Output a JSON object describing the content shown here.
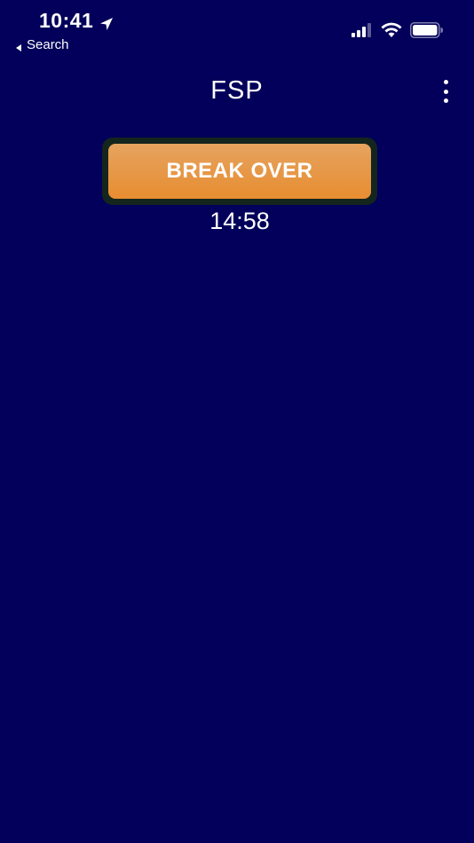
{
  "status_bar": {
    "time": "10:41",
    "back_label": "Search",
    "icons": [
      "location-arrow-icon",
      "signal-icon",
      "wifi-icon",
      "battery-icon"
    ]
  },
  "nav": {
    "title": "FSP",
    "more_icon": "more-vertical-icon"
  },
  "main": {
    "button_label": "BREAK OVER",
    "timer": "14:58"
  },
  "colors": {
    "background": "#02005a",
    "button_top": "#e5a35f",
    "button_bottom": "#e88d31",
    "button_border": "#14251d",
    "text": "#ffffff"
  }
}
